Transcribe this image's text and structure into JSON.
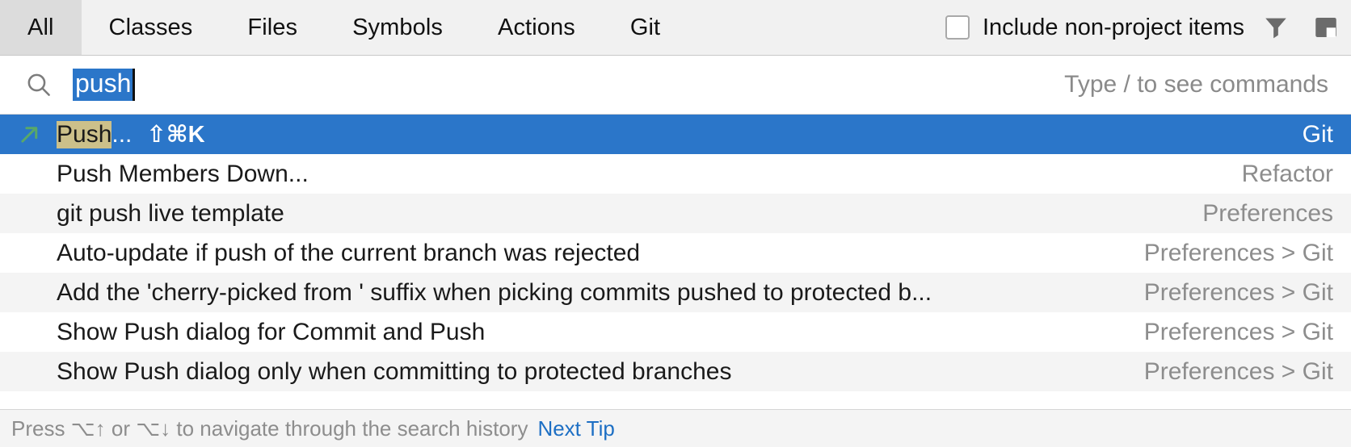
{
  "tabs": [
    {
      "label": "All",
      "selected": true
    },
    {
      "label": "Classes",
      "selected": false
    },
    {
      "label": "Files",
      "selected": false
    },
    {
      "label": "Symbols",
      "selected": false
    },
    {
      "label": "Actions",
      "selected": false
    },
    {
      "label": "Git",
      "selected": false
    }
  ],
  "toolbar": {
    "include_non_project_label": "Include non-project items",
    "include_non_project_checked": false,
    "filter_icon": "filter-funnel-icon",
    "preview_icon": "preview-panel-icon"
  },
  "search": {
    "icon": "search-magnifier-icon",
    "value": "push",
    "selected": true,
    "hint": "Type / to see commands"
  },
  "results": [
    {
      "icon": "green-arrow-up-right-icon",
      "match_prefix": "Push",
      "title_rest": "...",
      "shortcut": "⇧⌘K",
      "right": "Git",
      "selected": true
    },
    {
      "icon": "",
      "match_prefix": "",
      "title_rest": "Push Members Down...",
      "shortcut": "",
      "right": "Refactor",
      "selected": false
    },
    {
      "icon": "",
      "match_prefix": "",
      "title_rest": "git push live template",
      "shortcut": "",
      "right": "Preferences",
      "selected": false
    },
    {
      "icon": "",
      "match_prefix": "",
      "title_rest": "Auto-update if push of the current branch was rejected",
      "shortcut": "",
      "right": "Preferences > Git",
      "selected": false
    },
    {
      "icon": "",
      "match_prefix": "",
      "title_rest": "Add the 'cherry-picked from ' suffix when picking commits pushed to protected b...",
      "shortcut": "",
      "right": "Preferences > Git",
      "selected": false
    },
    {
      "icon": "",
      "match_prefix": "",
      "title_rest": "Show Push dialog for Commit and Push",
      "shortcut": "",
      "right": "Preferences > Git",
      "selected": false
    },
    {
      "icon": "",
      "match_prefix": "",
      "title_rest": "Show Push dialog only when committing to protected branches",
      "shortcut": "",
      "right": "Preferences > Git",
      "selected": false
    }
  ],
  "footer": {
    "text": "Press ⌥↑ or ⌥↓ to navigate through the search history",
    "link": "Next Tip"
  },
  "colors": {
    "selection_blue": "#2b76c9",
    "match_highlight": "#ccc08a",
    "link_blue": "#1d6fc4",
    "row_alt": "#f4f4f4",
    "tabbar_bg": "#f1f1f1",
    "tab_selected_bg": "#dcdcdc",
    "secondary_text": "#8d8d8d",
    "arrow_green": "#59a869"
  }
}
